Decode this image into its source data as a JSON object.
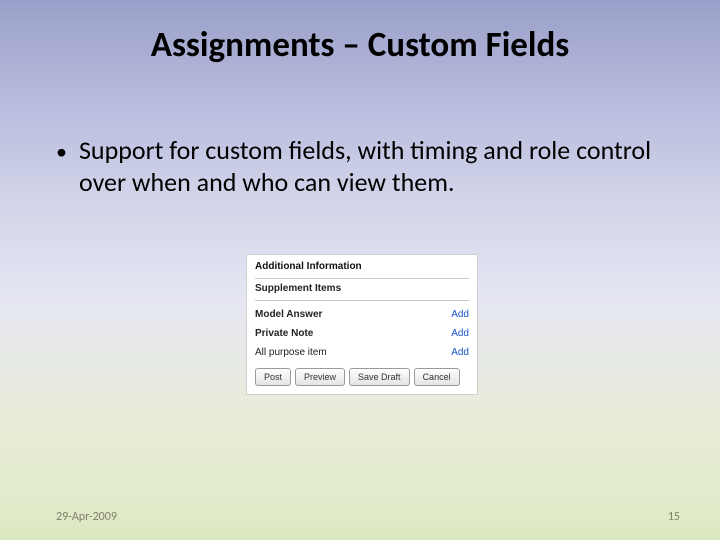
{
  "title": "Assignments – Custom Fields",
  "bullet": "Support for custom fields, with timing and role control over when and who can view them.",
  "panel": {
    "header": "Additional Information",
    "subheader": "Supplement Items",
    "rows": [
      {
        "label": "Model Answer",
        "bold": true,
        "link": "Add"
      },
      {
        "label": "Private Note",
        "bold": true,
        "link": "Add"
      },
      {
        "label": "All purpose item",
        "bold": false,
        "link": "Add"
      }
    ],
    "buttons": {
      "post": "Post",
      "preview": "Preview",
      "save_draft": "Save Draft",
      "cancel": "Cancel"
    }
  },
  "footer": {
    "date": "29-Apr-2009",
    "page": "15"
  }
}
